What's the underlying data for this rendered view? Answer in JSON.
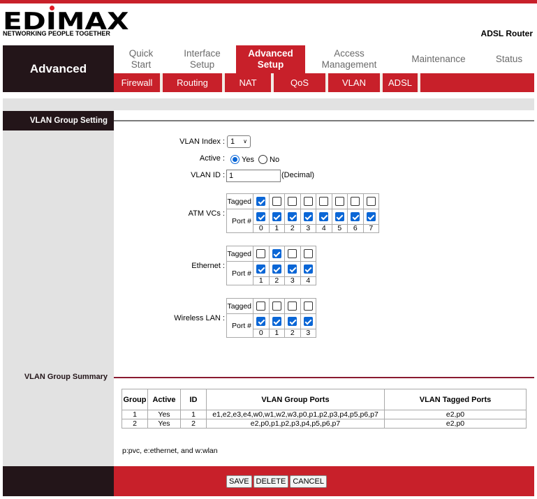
{
  "brand": {
    "logo": "EDIMAX",
    "tagline": "NETWORKING PEOPLE TOGETHER",
    "product": "ADSL Router",
    "accent_color": "#c8202a",
    "dark_color": "#231519"
  },
  "nav": {
    "section_title": "Advanced",
    "tabs": [
      {
        "label": "Quick\nStart",
        "active": false
      },
      {
        "label": "Interface\nSetup",
        "active": false
      },
      {
        "label": "Advanced\nSetup",
        "active": true
      },
      {
        "label": "Access\nManagement",
        "active": false
      },
      {
        "label": "Maintenance",
        "active": false
      },
      {
        "label": "Status",
        "active": false
      }
    ],
    "subtabs": [
      "Firewall",
      "Routing",
      "NAT",
      "QoS",
      "VLAN",
      "ADSL"
    ]
  },
  "vlan_setting": {
    "section_title": "VLAN Group Setting",
    "vlan_index_label": "VLAN Index :",
    "vlan_index_value": "1",
    "active_label": "Active :",
    "active_yes": "Yes",
    "active_no": "No",
    "active_selected": "Yes",
    "vlan_id_label": "VLAN ID :",
    "vlan_id_value": "1",
    "vlan_id_hint": "(Decimal)",
    "tagged_label": "Tagged",
    "port_label": "Port #",
    "atm": {
      "label": "ATM VCs :",
      "ports": [
        "0",
        "1",
        "2",
        "3",
        "4",
        "5",
        "6",
        "7"
      ],
      "tagged": [
        true,
        false,
        false,
        false,
        false,
        false,
        false,
        false
      ],
      "member": [
        true,
        true,
        true,
        true,
        true,
        true,
        true,
        true
      ]
    },
    "ethernet": {
      "label": "Ethernet :",
      "ports": [
        "1",
        "2",
        "3",
        "4"
      ],
      "tagged": [
        false,
        true,
        false,
        false
      ],
      "member": [
        true,
        true,
        true,
        true
      ]
    },
    "wireless": {
      "label": "Wireless LAN :",
      "ports": [
        "0",
        "1",
        "2",
        "3"
      ],
      "tagged": [
        false,
        false,
        false,
        false
      ],
      "member": [
        true,
        true,
        true,
        true
      ]
    }
  },
  "summary": {
    "section_title": "VLAN Group Summary",
    "headers": [
      "Group",
      "Active",
      "ID",
      "VLAN Group Ports",
      "VLAN Tagged Ports"
    ],
    "rows": [
      [
        "1",
        "Yes",
        "1",
        "e1,e2,e3,e4,w0,w1,w2,w3,p0,p1,p2,p3,p4,p5,p6,p7",
        "e2,p0"
      ],
      [
        "2",
        "Yes",
        "2",
        "e2,p0,p1,p2,p3,p4,p5,p6,p7",
        "e2,p0"
      ]
    ],
    "legend": "p:pvc, e:ethernet, and w:wlan"
  },
  "buttons": {
    "save": "SAVE",
    "delete": "DELETE",
    "cancel": "CANCEL"
  }
}
